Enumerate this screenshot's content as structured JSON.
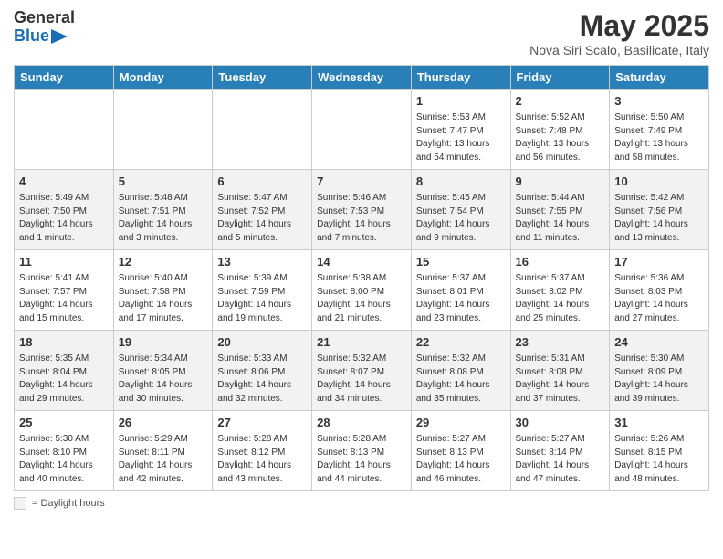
{
  "header": {
    "logo_general": "General",
    "logo_blue": "Blue",
    "title": "May 2025",
    "location": "Nova Siri Scalo, Basilicate, Italy"
  },
  "days_of_week": [
    "Sunday",
    "Monday",
    "Tuesday",
    "Wednesday",
    "Thursday",
    "Friday",
    "Saturday"
  ],
  "weeks": [
    [
      {
        "day": "",
        "info": ""
      },
      {
        "day": "",
        "info": ""
      },
      {
        "day": "",
        "info": ""
      },
      {
        "day": "",
        "info": ""
      },
      {
        "day": "1",
        "info": "Sunrise: 5:53 AM\nSunset: 7:47 PM\nDaylight: 13 hours\nand 54 minutes."
      },
      {
        "day": "2",
        "info": "Sunrise: 5:52 AM\nSunset: 7:48 PM\nDaylight: 13 hours\nand 56 minutes."
      },
      {
        "day": "3",
        "info": "Sunrise: 5:50 AM\nSunset: 7:49 PM\nDaylight: 13 hours\nand 58 minutes."
      }
    ],
    [
      {
        "day": "4",
        "info": "Sunrise: 5:49 AM\nSunset: 7:50 PM\nDaylight: 14 hours\nand 1 minute."
      },
      {
        "day": "5",
        "info": "Sunrise: 5:48 AM\nSunset: 7:51 PM\nDaylight: 14 hours\nand 3 minutes."
      },
      {
        "day": "6",
        "info": "Sunrise: 5:47 AM\nSunset: 7:52 PM\nDaylight: 14 hours\nand 5 minutes."
      },
      {
        "day": "7",
        "info": "Sunrise: 5:46 AM\nSunset: 7:53 PM\nDaylight: 14 hours\nand 7 minutes."
      },
      {
        "day": "8",
        "info": "Sunrise: 5:45 AM\nSunset: 7:54 PM\nDaylight: 14 hours\nand 9 minutes."
      },
      {
        "day": "9",
        "info": "Sunrise: 5:44 AM\nSunset: 7:55 PM\nDaylight: 14 hours\nand 11 minutes."
      },
      {
        "day": "10",
        "info": "Sunrise: 5:42 AM\nSunset: 7:56 PM\nDaylight: 14 hours\nand 13 minutes."
      }
    ],
    [
      {
        "day": "11",
        "info": "Sunrise: 5:41 AM\nSunset: 7:57 PM\nDaylight: 14 hours\nand 15 minutes."
      },
      {
        "day": "12",
        "info": "Sunrise: 5:40 AM\nSunset: 7:58 PM\nDaylight: 14 hours\nand 17 minutes."
      },
      {
        "day": "13",
        "info": "Sunrise: 5:39 AM\nSunset: 7:59 PM\nDaylight: 14 hours\nand 19 minutes."
      },
      {
        "day": "14",
        "info": "Sunrise: 5:38 AM\nSunset: 8:00 PM\nDaylight: 14 hours\nand 21 minutes."
      },
      {
        "day": "15",
        "info": "Sunrise: 5:37 AM\nSunset: 8:01 PM\nDaylight: 14 hours\nand 23 minutes."
      },
      {
        "day": "16",
        "info": "Sunrise: 5:37 AM\nSunset: 8:02 PM\nDaylight: 14 hours\nand 25 minutes."
      },
      {
        "day": "17",
        "info": "Sunrise: 5:36 AM\nSunset: 8:03 PM\nDaylight: 14 hours\nand 27 minutes."
      }
    ],
    [
      {
        "day": "18",
        "info": "Sunrise: 5:35 AM\nSunset: 8:04 PM\nDaylight: 14 hours\nand 29 minutes."
      },
      {
        "day": "19",
        "info": "Sunrise: 5:34 AM\nSunset: 8:05 PM\nDaylight: 14 hours\nand 30 minutes."
      },
      {
        "day": "20",
        "info": "Sunrise: 5:33 AM\nSunset: 8:06 PM\nDaylight: 14 hours\nand 32 minutes."
      },
      {
        "day": "21",
        "info": "Sunrise: 5:32 AM\nSunset: 8:07 PM\nDaylight: 14 hours\nand 34 minutes."
      },
      {
        "day": "22",
        "info": "Sunrise: 5:32 AM\nSunset: 8:08 PM\nDaylight: 14 hours\nand 35 minutes."
      },
      {
        "day": "23",
        "info": "Sunrise: 5:31 AM\nSunset: 8:08 PM\nDaylight: 14 hours\nand 37 minutes."
      },
      {
        "day": "24",
        "info": "Sunrise: 5:30 AM\nSunset: 8:09 PM\nDaylight: 14 hours\nand 39 minutes."
      }
    ],
    [
      {
        "day": "25",
        "info": "Sunrise: 5:30 AM\nSunset: 8:10 PM\nDaylight: 14 hours\nand 40 minutes."
      },
      {
        "day": "26",
        "info": "Sunrise: 5:29 AM\nSunset: 8:11 PM\nDaylight: 14 hours\nand 42 minutes."
      },
      {
        "day": "27",
        "info": "Sunrise: 5:28 AM\nSunset: 8:12 PM\nDaylight: 14 hours\nand 43 minutes."
      },
      {
        "day": "28",
        "info": "Sunrise: 5:28 AM\nSunset: 8:13 PM\nDaylight: 14 hours\nand 44 minutes."
      },
      {
        "day": "29",
        "info": "Sunrise: 5:27 AM\nSunset: 8:13 PM\nDaylight: 14 hours\nand 46 minutes."
      },
      {
        "day": "30",
        "info": "Sunrise: 5:27 AM\nSunset: 8:14 PM\nDaylight: 14 hours\nand 47 minutes."
      },
      {
        "day": "31",
        "info": "Sunrise: 5:26 AM\nSunset: 8:15 PM\nDaylight: 14 hours\nand 48 minutes."
      }
    ]
  ],
  "legend": {
    "box_label": "= Daylight hours"
  }
}
